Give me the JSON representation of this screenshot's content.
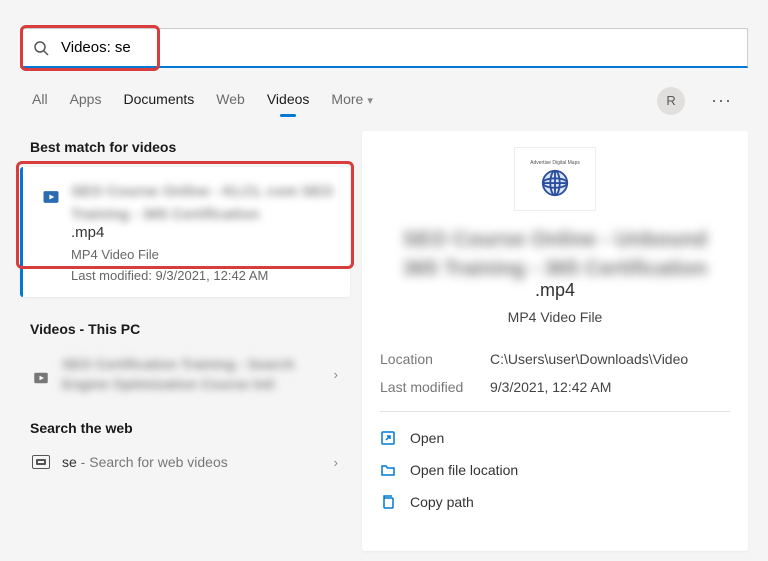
{
  "search": {
    "query": "Videos: se"
  },
  "tabs": {
    "all": "All",
    "apps": "Apps",
    "documents": "Documents",
    "web": "Web",
    "videos": "Videos",
    "more": "More"
  },
  "avatar_initial": "R",
  "left": {
    "best_match_h": "Best match for videos",
    "best_match": {
      "title_blur": "SEO Course Online - KLCL com SEO Training - 365 Certification",
      "ext": ".mp4",
      "file_type": "MP4 Video File",
      "last_modified_label": "Last modified: 9/3/2021, 12:42 AM"
    },
    "videos_thispc_h": "Videos - This PC",
    "videos_thispc_item_blur": "SEO Certification Training - Search Engine Optimization Course Intl",
    "search_web_h": "Search the web",
    "web_item_prefix": "se",
    "web_item_suffix": " - Search for web videos"
  },
  "preview": {
    "title_blur": "SEO Course Online - Unbound 365 Training - 365 Certification",
    "ext": ".mp4",
    "file_type": "MP4 Video File",
    "meta": {
      "location_k": "Location",
      "location_v": "C:\\Users\\user\\Downloads\\Video",
      "modified_k": "Last modified",
      "modified_v": "9/3/2021, 12:42 AM"
    },
    "actions": {
      "open": "Open",
      "open_loc": "Open file location",
      "copy_path": "Copy path"
    }
  }
}
